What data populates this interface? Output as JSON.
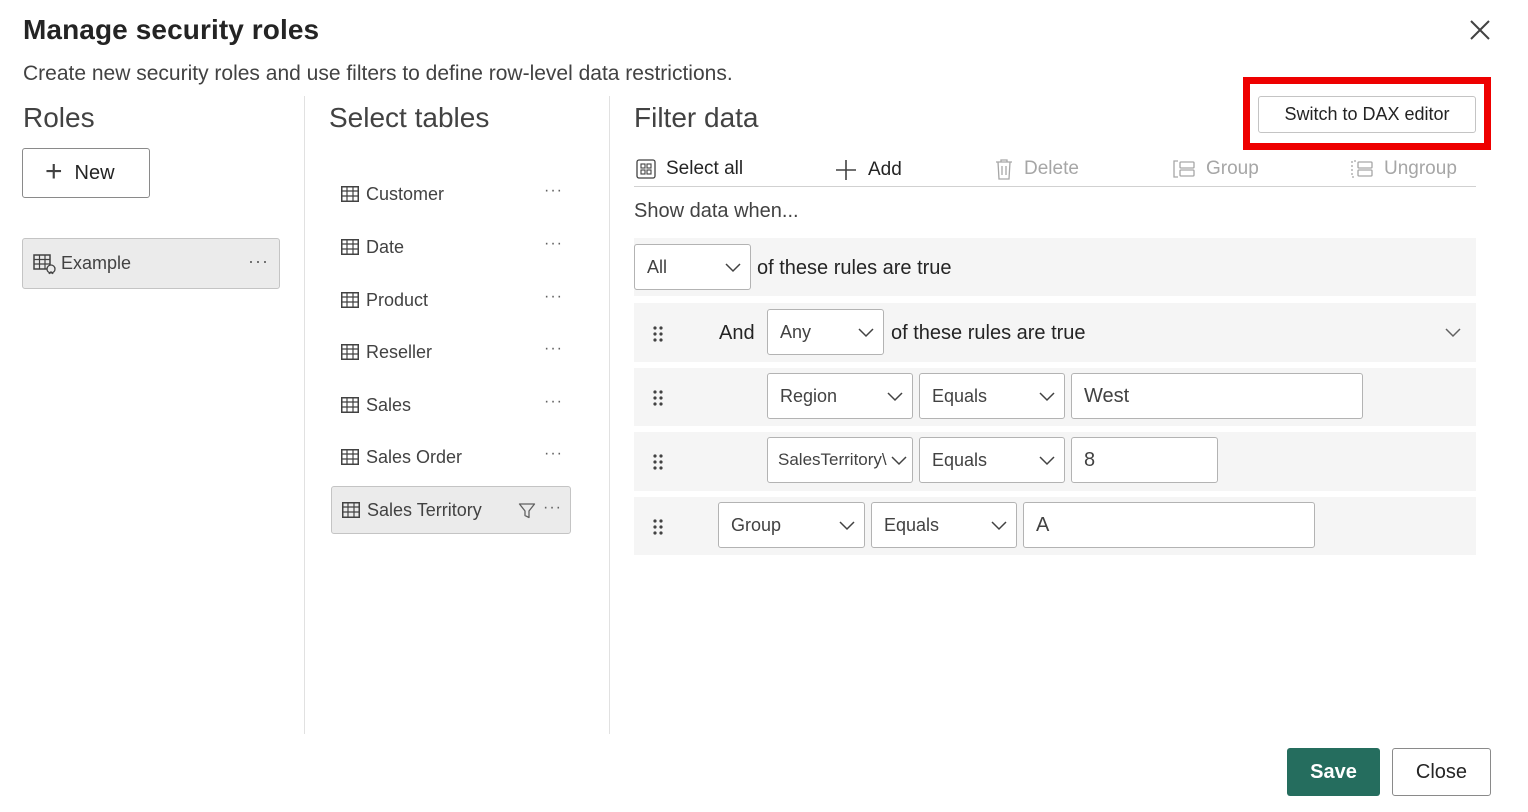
{
  "dialog": {
    "title": "Manage security roles",
    "subtitle": "Create new security roles and use filters to define row-level data restrictions."
  },
  "roles": {
    "heading": "Roles",
    "new_label": "New",
    "items": [
      {
        "label": "Example",
        "selected": true
      }
    ]
  },
  "tables": {
    "heading": "Select tables",
    "items": [
      {
        "label": "Customer"
      },
      {
        "label": "Date"
      },
      {
        "label": "Product"
      },
      {
        "label": "Reseller"
      },
      {
        "label": "Sales"
      },
      {
        "label": "Sales Order"
      },
      {
        "label": "Sales Territory",
        "selected": true,
        "has_filter": true
      }
    ]
  },
  "filter": {
    "heading": "Filter data",
    "dax_button": "Switch to DAX editor",
    "toolbar": {
      "select_all": "Select all",
      "add": "Add",
      "delete": "Delete",
      "group": "Group",
      "ungroup": "Ungroup"
    },
    "show_when": "Show data when...",
    "top_rule": {
      "quantifier": "All",
      "text": "of these rules are true"
    },
    "group_rule": {
      "conjunction": "And",
      "quantifier": "Any",
      "text": "of these rules are true"
    },
    "rule1": {
      "field": "Region",
      "operator": "Equals",
      "value": "West"
    },
    "rule2": {
      "field": "SalesTerritory\\",
      "operator": "Equals",
      "value": "8"
    },
    "rule3": {
      "field": "Group",
      "operator": "Equals",
      "value": "A"
    }
  },
  "footer": {
    "save": "Save",
    "close": "Close"
  },
  "colors": {
    "primary": "#256d5e",
    "highlight": "#ee0000",
    "row_bg": "#f5f5f5",
    "selected_bg": "#ebebeb"
  }
}
